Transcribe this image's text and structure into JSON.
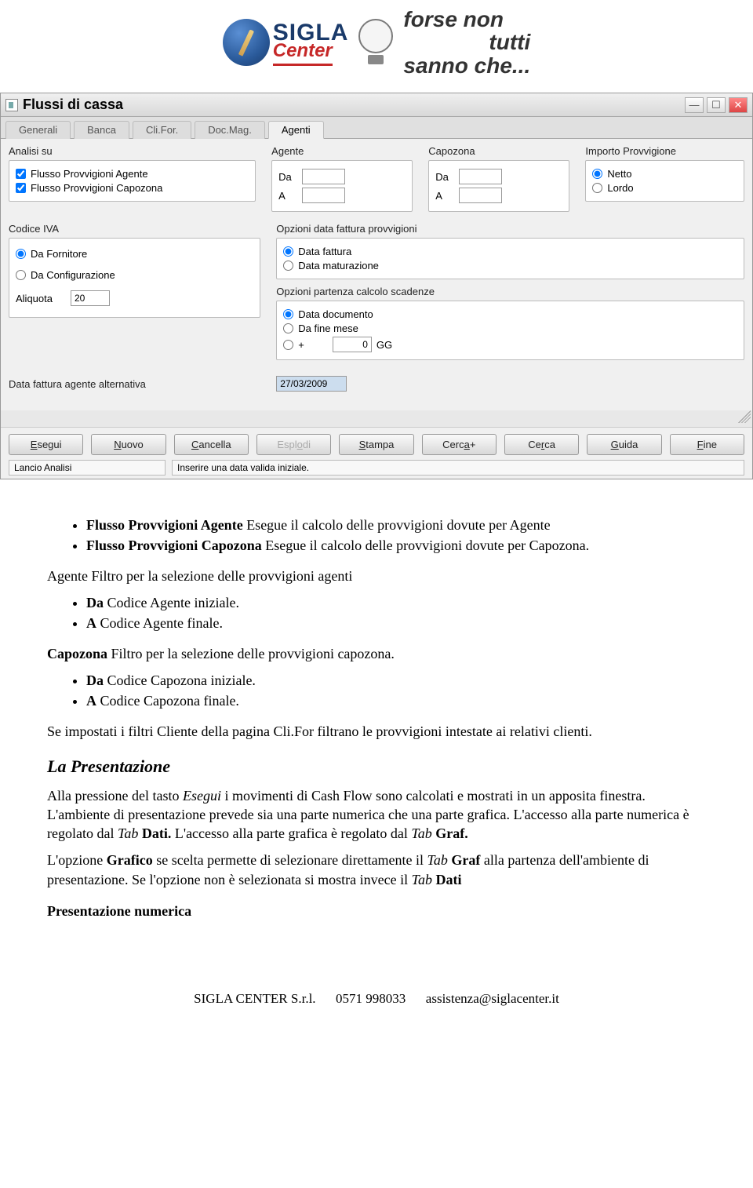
{
  "header": {
    "brand1": "SIGLA",
    "brand2": "Center",
    "slogan_line1": "forse non",
    "slogan_line2": "tutti",
    "slogan_line3": "sanno che..."
  },
  "window": {
    "title": "Flussi di cassa",
    "tabs": [
      "Generali",
      "Banca",
      "Cli.For.",
      "Doc.Mag.",
      "Agenti"
    ],
    "active_tab_index": 4,
    "section_analisi": {
      "label": "Analisi su",
      "check1": "Flusso Provvigioni Agente",
      "check2": "Flusso Provvigioni Capozona"
    },
    "section_agente": {
      "label": "Agente",
      "da": "Da",
      "a": "A"
    },
    "section_capozona": {
      "label": "Capozona",
      "da": "Da",
      "a": "A"
    },
    "section_importo": {
      "label": "Importo Provvigione",
      "netto": "Netto",
      "lordo": "Lordo"
    },
    "section_codiva": {
      "label": "Codice IVA",
      "opt1": "Da Fornitore",
      "opt2": "Da Configurazione",
      "aliq_label": "Aliquota",
      "aliq_value": "20"
    },
    "section_opz_fatt": {
      "label": "Opzioni data fattura provvigioni",
      "opt1": "Data fattura",
      "opt2": "Data maturazione"
    },
    "section_opz_scad": {
      "label": "Opzioni partenza calcolo scadenze",
      "opt1": "Data documento",
      "opt2": "Da fine mese",
      "opt3": "+",
      "gg_value": "0",
      "gg_label": "GG"
    },
    "data_fatt_alt": {
      "label": "Data fattura agente alternativa",
      "value": "27/03/2009"
    },
    "buttons": {
      "esegui": "Esegui",
      "nuovo": "Nuovo",
      "cancella": "Cancella",
      "esplodi": "Esplodi",
      "stampa": "Stampa",
      "cercap": "Cerca+",
      "cerca": "Cerca",
      "guida": "Guida",
      "fine": "Fine"
    },
    "status1": "Lancio Analisi",
    "status2": "Inserire una data valida iniziale."
  },
  "doc": {
    "bul1a": "Flusso Provvigioni Agente",
    "bul1b": " Esegue il calcolo delle provvigioni dovute per Agente",
    "bul2a": "Flusso Provvigioni Capozona",
    "bul2b": " Esegue il calcolo delle provvigioni dovute per Capozona.",
    "p_agente": "Agente Filtro per la selezione delle provvigioni agenti",
    "bul3a": "Da",
    "bul3b": " Codice Agente iniziale.",
    "bul4a": "A",
    "bul4b": " Codice Agente finale.",
    "p_capo": "Capozona",
    "p_capo2": " Filtro per la selezione delle provvigioni capozona.",
    "bul5a": "Da",
    "bul5b": " Codice Capozona iniziale.",
    "bul6a": "A",
    "bul6b": " Codice Capozona finale.",
    "p_filtri": "Se impostati i filtri Cliente della pagina Cli.For filtrano le provvigioni intestate ai relativi clienti.",
    "h_pres": "La Presentazione",
    "p_pres1a": "Alla pressione del tasto ",
    "p_pres1b": "Esegui",
    "p_pres1c": " i movimenti di Cash Flow sono calcolati e mostrati in un apposita finestra. L'ambiente di presentazione prevede sia una parte numerica che una parte grafica. L'accesso alla parte numerica è regolato dal ",
    "p_pres1d": "Tab",
    "p_pres1e": " ",
    "p_pres1f": "Dati.",
    "p_pres1g": " L'accesso alla parte grafica è regolato dal ",
    "p_pres1h": "Tab",
    "p_pres1i": " ",
    "p_pres1j": "Graf.",
    "p_pres2a": "L'opzione ",
    "p_pres2b": "Grafico",
    "p_pres2c": " se scelta permette di selezionare direttamente il ",
    "p_pres2d": "Tab",
    "p_pres2e": " ",
    "p_pres2f": "Graf",
    "p_pres2g": " alla partenza dell'ambiente di presentazione. Se l'opzione non è selezionata si mostra invece il ",
    "p_pres2h": "Tab",
    "p_pres2i": " ",
    "p_pres2j": "Dati",
    "h_presnum": "Presentazione numerica"
  },
  "footer": {
    "company": "SIGLA CENTER  S.r.l.",
    "phone": "0571 998033",
    "email": "assistenza@siglacenter.it"
  }
}
